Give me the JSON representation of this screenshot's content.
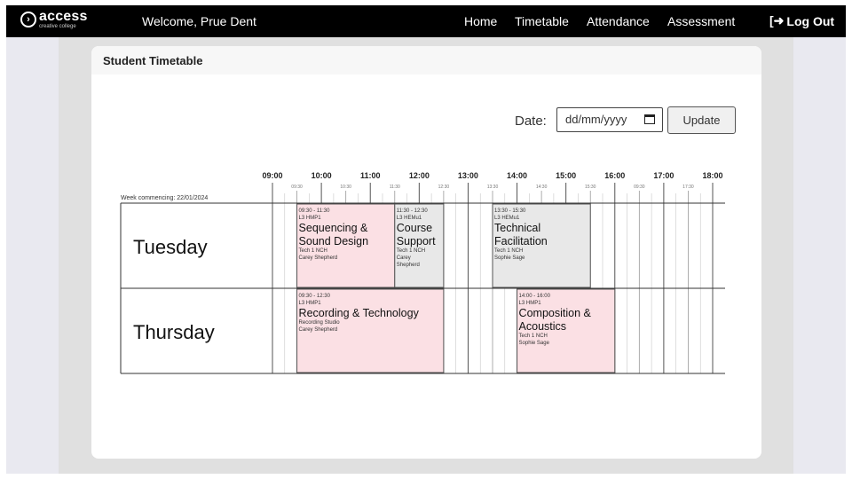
{
  "header": {
    "logo_main": "access",
    "logo_sub": "creative college",
    "welcome": "Welcome, Prue Dent",
    "nav": [
      {
        "key": "home",
        "label": "Home"
      },
      {
        "key": "timetable",
        "label": "Timetable"
      },
      {
        "key": "attendance",
        "label": "Attendance"
      },
      {
        "key": "assessment",
        "label": "Assessment"
      }
    ],
    "logout_label": "Log Out"
  },
  "page": {
    "title": "Student Timetable",
    "date_label": "Date:",
    "date_placeholder": "dd/mm/yyyy",
    "update_label": "Update"
  },
  "timetable": {
    "week_label": "Week commencing: 22/01/2024",
    "start_time": "09:00",
    "end_time": "18:00",
    "hour_labels": [
      "09:00",
      "10:00",
      "11:00",
      "12:00",
      "13:00",
      "14:00",
      "15:00",
      "16:00",
      "17:00",
      "18:00"
    ],
    "half_labels": [
      "09:30",
      "10:30",
      "11:30",
      "12:30",
      "13:30",
      "14:30",
      "15:30",
      "09:30",
      "17:30"
    ],
    "days": [
      {
        "name": "Tuesday",
        "sessions": [
          {
            "start": "09:30",
            "end": "11:30",
            "time": "09:30 - 11:30",
            "group": "L3 HMP1",
            "title": [
              "Sequencing &",
              "Sound Design"
            ],
            "room": "Tech 1 NCH",
            "tutor": [
              "Carey Shepherd"
            ],
            "color": "#fbe0e4"
          },
          {
            "start": "11:30",
            "end": "12:30",
            "time": "11:30 - 12:30",
            "group": "L3 HEMu1",
            "title": [
              "Course",
              "Support"
            ],
            "room": "Tech 1 NCH",
            "tutor": [
              "Carey",
              "Shepherd"
            ],
            "color": "#e8e8e8"
          },
          {
            "start": "13:30",
            "end": "15:30",
            "time": "13:30 - 15:30",
            "group": "L3 HEMu1",
            "title": [
              "Technical",
              "Facilitation"
            ],
            "room": "Tech 1 NCH",
            "tutor": [
              "Sophie Sage"
            ],
            "color": "#e8e8e8"
          }
        ]
      },
      {
        "name": "Thursday",
        "sessions": [
          {
            "start": "09:30",
            "end": "12:30",
            "time": "09:30 - 12:30",
            "group": "L3 HMP1",
            "title": [
              "Recording & Technology"
            ],
            "room": "Recording Studio",
            "tutor": [
              "Carey Shepherd"
            ],
            "color": "#fbe0e4"
          },
          {
            "start": "14:00",
            "end": "16:00",
            "time": "14:00 - 16:00",
            "group": "L3 HMP1",
            "title": [
              "Composition &",
              "Acoustics"
            ],
            "room": "Tech 1 NCH",
            "tutor": [
              "Sophie Sage"
            ],
            "color": "#fbe0e4"
          }
        ]
      }
    ]
  }
}
